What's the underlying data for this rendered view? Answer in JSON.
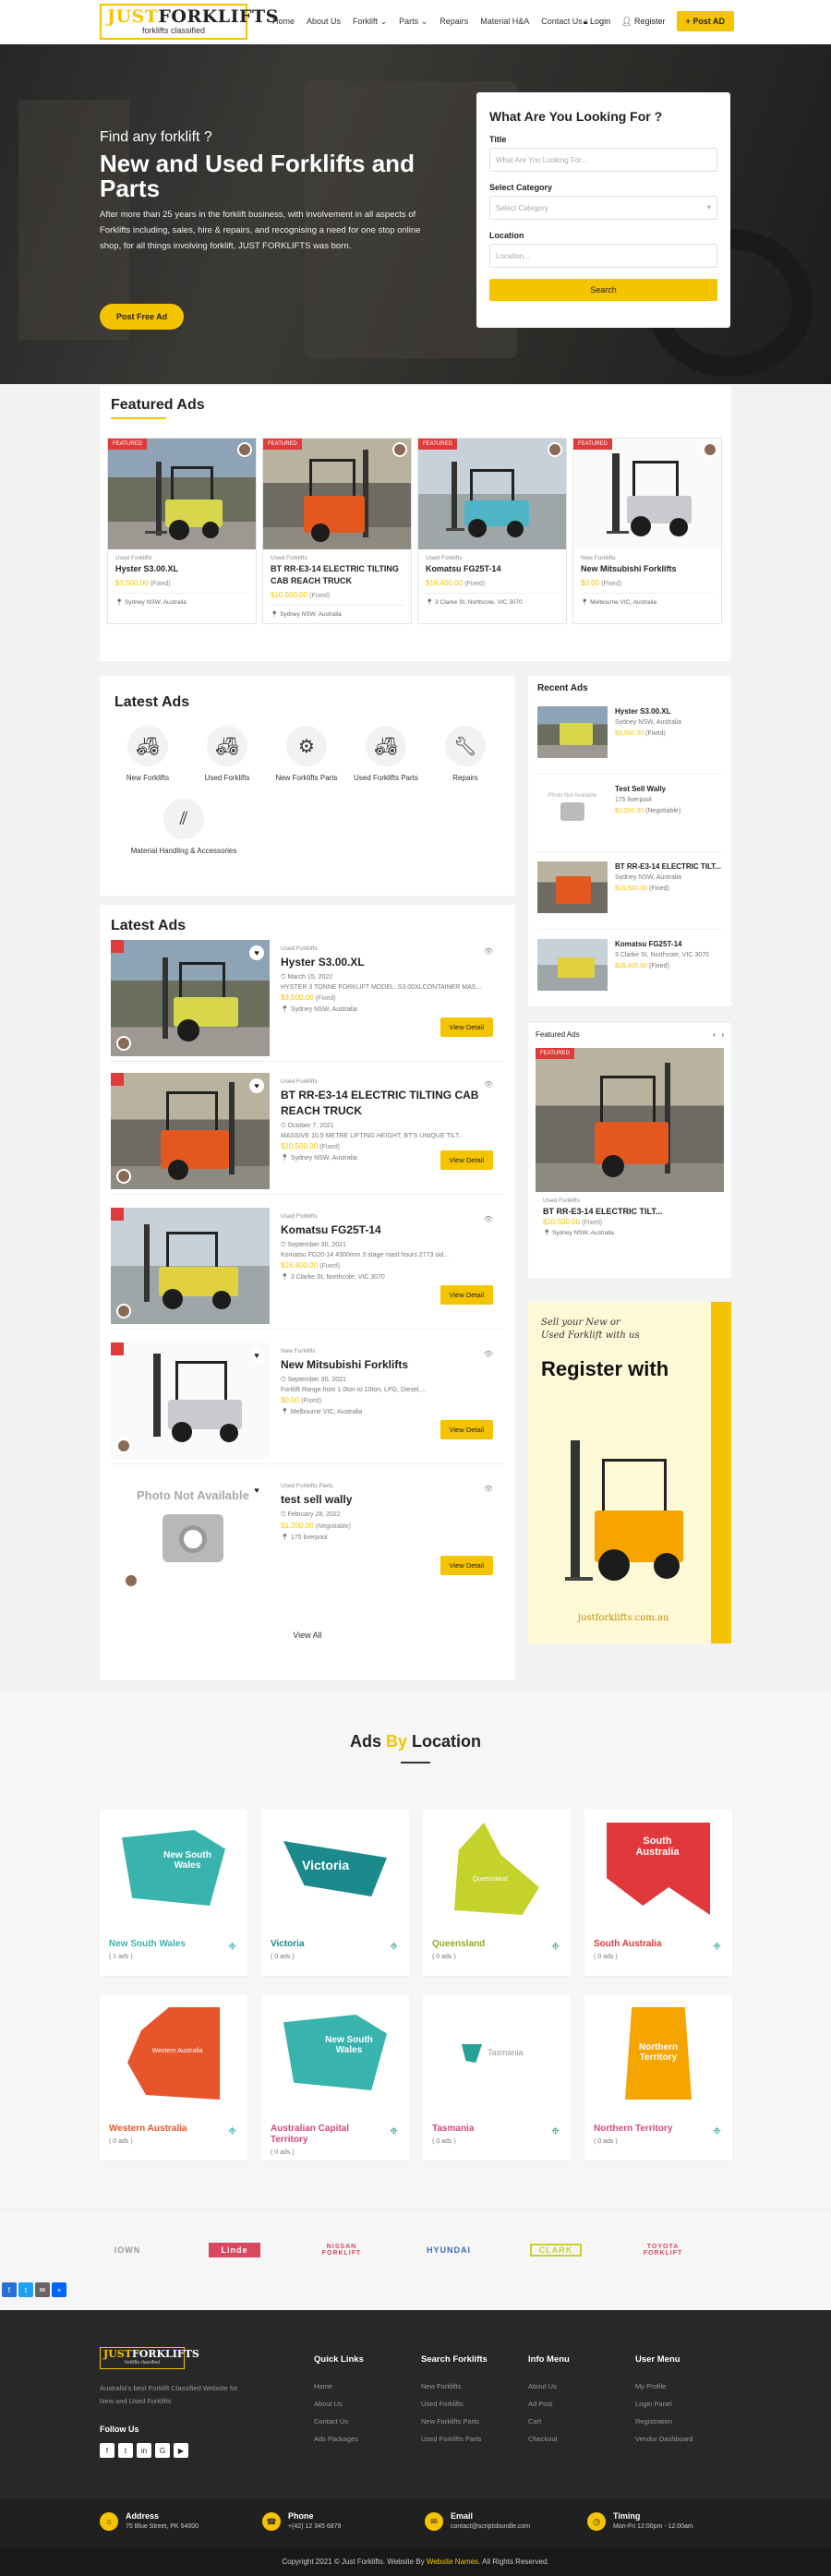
{
  "header": {
    "logo_title": "JUSTFORKLIFTS",
    "logo_j": "JUST",
    "logo_rest": "FORKLIFTS",
    "logo_tagline": "forklifts classified",
    "nav": [
      "Home",
      "About Us",
      "Forklift",
      "Parts",
      "Repairs",
      "Material H&A",
      "Contact Us"
    ],
    "login": "Login",
    "register": "Register",
    "post_ad": "Post AD"
  },
  "hero": {
    "subtitle": "Find any forklift ?",
    "title": "New and Used Forklifts and Parts",
    "description": "After more than 25 years in the forklift business, with involvement in all aspects of Forklifts including, sales, hire & repairs, and recognising a need for one stop online shop, for all things involving forklift, JUST FORKLIFTS was born.",
    "button": "Post Free Ad"
  },
  "search": {
    "heading": "What Are You Looking For ?",
    "title_label": "Title",
    "title_placeholder": "What Are You Looking For...",
    "category_label": "Select Category",
    "category_value": "Select Category",
    "location_label": "Location",
    "location_placeholder": "Location...",
    "button": "Search"
  },
  "featured": {
    "title": "Featured Ads",
    "badge": "FEATURED",
    "items": [
      {
        "cat": "Used Forklifts",
        "title": "Hyster S3.00.XL",
        "price": "$3,500.00",
        "ptype": "(Fixed)",
        "loc": "Sydney NSW, Australia"
      },
      {
        "cat": "Used Forklifts",
        "title": "BT RR-E3-14 ELECTRIC TILTING CAB REACH TRUCK",
        "price": "$10,500.00",
        "ptype": "(Fixed)",
        "loc": "Sydney NSW, Australia"
      },
      {
        "cat": "Used Forklifts",
        "title": "Komatsu FG25T-14",
        "price": "$16,400.00",
        "ptype": "(Fixed)",
        "loc": "3 Clarke St, Northcote, VIC 3070"
      },
      {
        "cat": "New Forklifts",
        "title": "New Mitsubishi Forklifts",
        "price": "$0.00",
        "ptype": "(Fixed)",
        "loc": "Melbourne VIC, Australia"
      }
    ]
  },
  "categories": {
    "title": "Latest Ads",
    "items": [
      "New Forklifts",
      "Used Forklifts",
      "New Forklifts Parts",
      "Used Forklifts Parts",
      "Repairs",
      "Material Handling & Accessories"
    ]
  },
  "latest": {
    "title": "Latest Ads",
    "view_detail": "View Detail",
    "view_all": "View All",
    "photo_na": "Photo Not Available",
    "items": [
      {
        "cat": "Used Forklifts",
        "title": "Hyster S3.00.XL",
        "date": "March 15, 2022",
        "desc": "HYSTER 3 TONNE FORKLIFT MODEL: S3.00XLCONTAINER MAS...",
        "price": "$3,500.00",
        "ptype": "(Fixed)",
        "loc": "Sydney NSW, Australia"
      },
      {
        "cat": "Used Forklifts",
        "title": "BT RR-E3-14 ELECTRIC TILTING CAB REACH TRUCK",
        "date": "October 7, 2021",
        "desc": "MASSIVE 10.5 METRE LIFTING HEIGHT, BT'S UNIQUE TILT...",
        "price": "$10,500.00",
        "ptype": "(Fixed)",
        "loc": "Sydney NSW, Australia"
      },
      {
        "cat": "Used Forklifts",
        "title": "Komatsu FG25T-14",
        "date": "September 30, 2021",
        "desc": "Komatsu FG20-14 4300mm 3 stage mast hours 2773 sid...",
        "price": "$16,400.00",
        "ptype": "(Fixed)",
        "loc": "3 Clarke St, Northcote, VIC 3070"
      },
      {
        "cat": "New Forklifts",
        "title": "New Mitsubishi Forklifts",
        "date": "September 30, 2021",
        "desc": "Forklift Range from 1.0ton to 10ton, LPG, Diesel,...",
        "price": "$0.00",
        "ptype": "(Fixed)",
        "loc": "Melbourne VIC, Australia"
      },
      {
        "cat": "Used Forklifts Parts",
        "title": "test sell wally",
        "date": "February 28, 2022",
        "desc": "",
        "price": "$1,200.00",
        "ptype": "(Negotiable)",
        "loc": "175 liverpool"
      }
    ]
  },
  "recent": {
    "title": "Recent Ads",
    "photo_na": "Photo Not Available",
    "items": [
      {
        "title": "Hyster S3.00.XL",
        "loc": "Sydney NSW, Australia",
        "price": "$3,500.00",
        "ptype": "(Fixed)"
      },
      {
        "title": "Test Sell Wally",
        "loc": "175 liverpool",
        "price": "$1,200.00",
        "ptype": "(Negotiable)"
      },
      {
        "title": "BT RR-E3-14 ELECTRIC TILT...",
        "loc": "Sydney NSW, Australia",
        "price": "$10,500.00",
        "ptype": "(Fixed)"
      },
      {
        "title": "Komatsu FG25T-14",
        "loc": "3 Clarke St, Northcote, VIC 3070",
        "price": "$16,400.00",
        "ptype": "(Fixed)"
      }
    ]
  },
  "side_featured": {
    "title": "Featured Ads",
    "badge": "FEATURED",
    "cat": "Used Forklifts",
    "item_title": "BT RR-E3-14 ELECTRIC TILT...",
    "price": "$10,500.00",
    "ptype": "(Fixed)",
    "loc": "Sydney NSW, Australia"
  },
  "promo": {
    "line1": "Sell your New or",
    "line2": "Used Forklift with us",
    "register": "Register with",
    "site": "justforklifts.com.au"
  },
  "locations": {
    "title_a": "Ads ",
    "title_b": "By",
    "title_c": " Location",
    "items": [
      {
        "name": "New South Wales",
        "count": "( 1 ads )",
        "map": "New South Wales",
        "color": "#39b3ae"
      },
      {
        "name": "Victoria",
        "count": "( 0 ads )",
        "map": "Victoria",
        "color": "#1a8a8c"
      },
      {
        "name": "Queensland",
        "count": "( 0 ads )",
        "map": "Queensland",
        "color": "#c5d22b"
      },
      {
        "name": "South Australia",
        "count": "( 0 ads )",
        "map": "South Australia",
        "color": "#e0383b"
      },
      {
        "name": "Western Australia",
        "count": "( 0 ads )",
        "map": "Western Australia",
        "color": "#e8552a"
      },
      {
        "name": "Australian Capital Territory",
        "count": "( 0 ads )",
        "map": "New South Wales",
        "color": "#39b3ae"
      },
      {
        "name": "Tasmania",
        "count": "( 0 ads )",
        "map": "Tasmania",
        "color": "#2aa198"
      },
      {
        "name": "Northern Territory",
        "count": "( 0 ads )",
        "map": "Northern Territory",
        "color": "#f5a400"
      }
    ]
  },
  "brands": [
    "IOWN",
    "Linde",
    "NISSAN FORKLIFT",
    "HYUNDAI",
    "CLARK",
    "TOYOTA FORKLIFT"
  ],
  "footer": {
    "desc": "Australia's best Forklift Classified Website for New and Used Forklifts",
    "follow": "Follow Us",
    "quick_links": {
      "title": "Quick Links",
      "items": [
        "Home",
        "About Us",
        "Contact Us",
        "Ads Packages"
      ]
    },
    "search_forklifts": {
      "title": "Search Forklifts",
      "items": [
        "New Forklifts",
        "Used Forklifts",
        "New Forklifts Parts",
        "Used Forklifts Parts"
      ]
    },
    "info_menu": {
      "title": "Info Menu",
      "items": [
        "About Us",
        "Ad Post",
        "Cart",
        "Checkout"
      ]
    },
    "user_menu": {
      "title": "User Menu",
      "items": [
        "My Profile",
        "Login Panel",
        "Registration",
        "Vendor Dashboard"
      ]
    }
  },
  "contact": {
    "address_label": "Address",
    "address": "75 Blue Street, PK 54000",
    "phone_label": "Phone",
    "phone": "+(42) 12 345 6879",
    "email_label": "Email",
    "email": "contact@scriptsbundle.com",
    "timing_label": "Timing",
    "timing": "Mon-Fri 12:00pm - 12:00am"
  },
  "copyright": {
    "pre": "Copyright 2021 © Just Forklifts. Website By ",
    "link": "Website Names",
    "post": ". All Rights Reserved."
  },
  "colors": {
    "accent": "#f5c400",
    "badge": "#e03b3b",
    "dark": "#282828"
  }
}
